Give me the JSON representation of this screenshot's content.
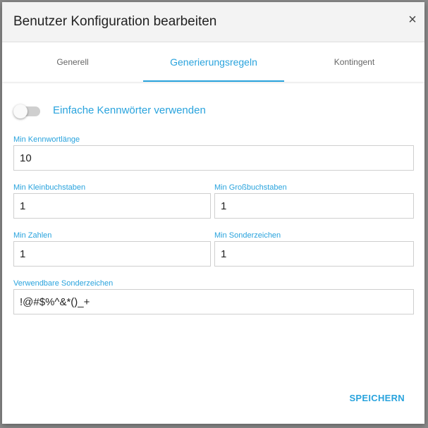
{
  "dialog": {
    "title": "Benutzer Konfiguration bearbeiten",
    "close_icon": "close-icon",
    "close_glyph": "×"
  },
  "tabs": [
    {
      "label": "Generell",
      "active": false
    },
    {
      "label": "Generierungsregeln",
      "active": true
    },
    {
      "label": "Kontingent",
      "active": false
    }
  ],
  "toggle": {
    "label": "Einfache Kennwörter verwenden",
    "checked": false
  },
  "fields": {
    "min_length": {
      "label": "Min Kennwortlänge",
      "value": "10"
    },
    "min_lower": {
      "label": "Min Kleinbuchstaben",
      "value": "1"
    },
    "min_upper": {
      "label": "Min Großbuchstaben",
      "value": "1"
    },
    "min_digits": {
      "label": "Min Zahlen",
      "value": "1"
    },
    "min_special": {
      "label": "Min Sonderzeichen",
      "value": "1"
    },
    "special_chars": {
      "label": "Verwendbare Sonderzeichen",
      "value": "!@#$%^&*()_+"
    }
  },
  "actions": {
    "save_label": "SPEICHERN"
  },
  "colors": {
    "accent": "#29a3dd",
    "header_bg": "#f3f3f3",
    "backdrop": "#8a8a8a"
  }
}
